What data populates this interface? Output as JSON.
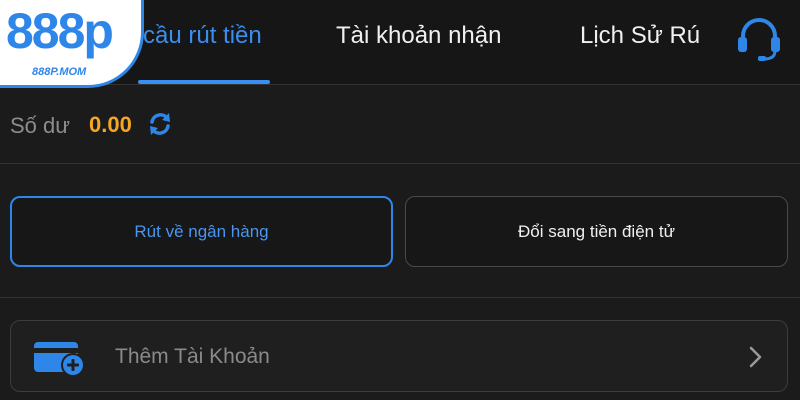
{
  "brand": {
    "logo_text": "888p",
    "logo_sub": "888P.MOM"
  },
  "tabs": [
    {
      "label": "cầu rút tiền",
      "active": true
    },
    {
      "label": "Tài khoản nhận",
      "active": false
    },
    {
      "label": "Lịch Sử Rú",
      "active": false
    }
  ],
  "header": {
    "support_icon": "headset-icon"
  },
  "balance": {
    "label": "Số dư",
    "value": "0.00",
    "refresh_icon": "refresh-icon"
  },
  "methods": [
    {
      "label": "Rút về ngân hàng",
      "selected": true
    },
    {
      "label": "Đổi sang tiền điện tử",
      "selected": false
    }
  ],
  "add_account": {
    "label": "Thêm Tài Khoản",
    "icon": "wallet-add-icon",
    "chevron": "chevron-right-icon"
  },
  "colors": {
    "accent": "#2e86e8",
    "balance": "#f5a623",
    "background": "#1b1b1b"
  }
}
